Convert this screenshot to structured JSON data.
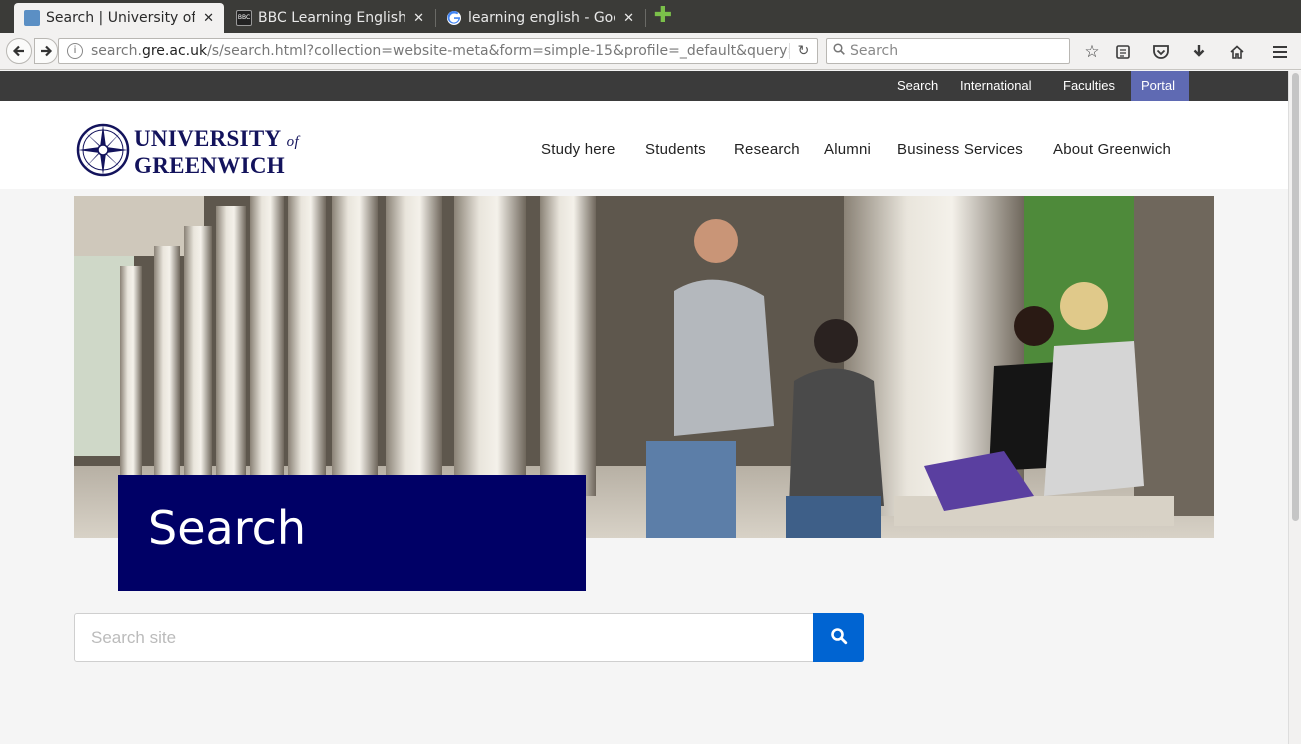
{
  "browser": {
    "tabs": [
      {
        "title": "Search | University of Greenwich",
        "active": true
      },
      {
        "title": "BBC Learning English",
        "active": false
      },
      {
        "title": "learning english - Google Search",
        "active": false
      }
    ],
    "url_prefix": "search.",
    "url_domain": "gre.ac.uk",
    "url_path": "/s/search.html?collection=website-meta&form=simple-15&profile=_default&query=",
    "search_placeholder": "Search",
    "colors": {
      "chrome_dark": "#3b3b38",
      "new_tab_plus": "#7bc04a"
    }
  },
  "utility_nav": {
    "items": [
      "Search",
      "International",
      "Faculties",
      "Portal"
    ],
    "portal_color": "#5f6ab3"
  },
  "logo": {
    "line1": "UNIVERSITY",
    "of": "of",
    "line2": "GREENWICH",
    "color": "#13135c"
  },
  "main_nav": {
    "items": [
      "Study here",
      "Students",
      "Research",
      "Alumni",
      "Business Services",
      "About Greenwich"
    ]
  },
  "hero": {
    "title": "Search",
    "title_box_color": "#000066"
  },
  "search": {
    "placeholder": "Search site",
    "button_color": "#0064d2"
  }
}
